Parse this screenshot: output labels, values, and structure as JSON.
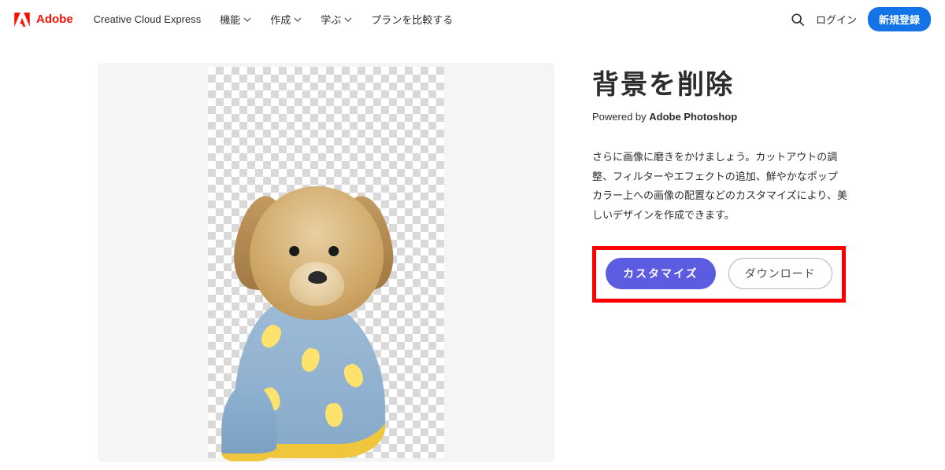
{
  "header": {
    "brand": "Adobe",
    "nav": {
      "creative_cloud_express": "Creative Cloud Express",
      "features": "機能",
      "create": "作成",
      "learn": "学ぶ",
      "compare_plans": "プランを比較する"
    },
    "login": "ログイン",
    "signup": "新規登録"
  },
  "main": {
    "title": "背景を削除",
    "powered_by_prefix": "Powered by ",
    "powered_by_product": "Adobe Photoshop",
    "description": "さらに画像に磨きをかけましょう。カットアウトの調整、フィルターやエフェクトの追加、鮮やかなポップカラー上への画像の配置などのカスタマイズにより、美しいデザインを作成できます。",
    "customize_label": "カスタマイズ",
    "download_label": "ダウンロード"
  }
}
